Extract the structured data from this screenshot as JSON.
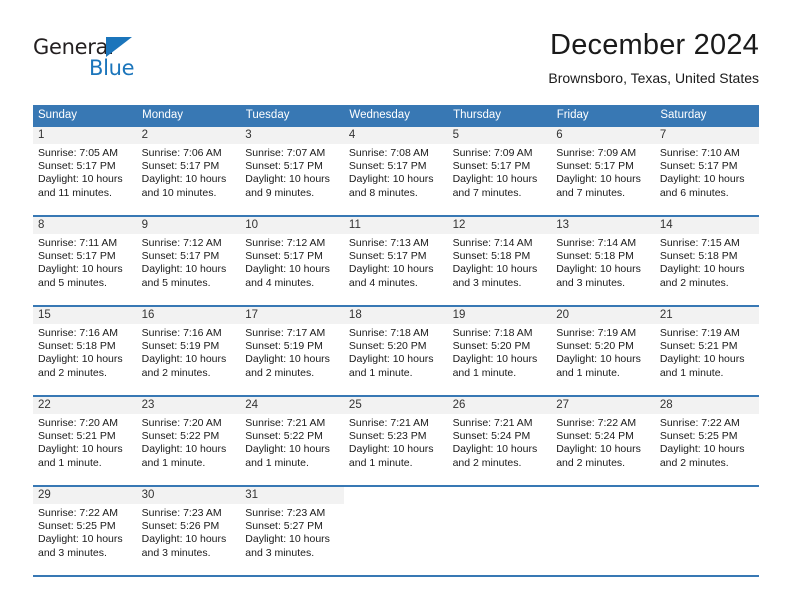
{
  "brand": {
    "name_part1": "General",
    "name_part2": "Blue",
    "accent_color": "#1b75bb"
  },
  "header": {
    "title": "December 2024",
    "subtitle": "Brownsboro, Texas, United States"
  },
  "calendar": {
    "header_bg": "#3878b4",
    "daynum_bg": "#f2f2f2",
    "weekday_headers": [
      "Sunday",
      "Monday",
      "Tuesday",
      "Wednesday",
      "Thursday",
      "Friday",
      "Saturday"
    ],
    "weeks": [
      [
        {
          "day": "1",
          "sunrise": "Sunrise: 7:05 AM",
          "sunset": "Sunset: 5:17 PM",
          "daylight_line1": "Daylight: 10 hours",
          "daylight_line2": "and 11 minutes."
        },
        {
          "day": "2",
          "sunrise": "Sunrise: 7:06 AM",
          "sunset": "Sunset: 5:17 PM",
          "daylight_line1": "Daylight: 10 hours",
          "daylight_line2": "and 10 minutes."
        },
        {
          "day": "3",
          "sunrise": "Sunrise: 7:07 AM",
          "sunset": "Sunset: 5:17 PM",
          "daylight_line1": "Daylight: 10 hours",
          "daylight_line2": "and 9 minutes."
        },
        {
          "day": "4",
          "sunrise": "Sunrise: 7:08 AM",
          "sunset": "Sunset: 5:17 PM",
          "daylight_line1": "Daylight: 10 hours",
          "daylight_line2": "and 8 minutes."
        },
        {
          "day": "5",
          "sunrise": "Sunrise: 7:09 AM",
          "sunset": "Sunset: 5:17 PM",
          "daylight_line1": "Daylight: 10 hours",
          "daylight_line2": "and 7 minutes."
        },
        {
          "day": "6",
          "sunrise": "Sunrise: 7:09 AM",
          "sunset": "Sunset: 5:17 PM",
          "daylight_line1": "Daylight: 10 hours",
          "daylight_line2": "and 7 minutes."
        },
        {
          "day": "7",
          "sunrise": "Sunrise: 7:10 AM",
          "sunset": "Sunset: 5:17 PM",
          "daylight_line1": "Daylight: 10 hours",
          "daylight_line2": "and 6 minutes."
        }
      ],
      [
        {
          "day": "8",
          "sunrise": "Sunrise: 7:11 AM",
          "sunset": "Sunset: 5:17 PM",
          "daylight_line1": "Daylight: 10 hours",
          "daylight_line2": "and 5 minutes."
        },
        {
          "day": "9",
          "sunrise": "Sunrise: 7:12 AM",
          "sunset": "Sunset: 5:17 PM",
          "daylight_line1": "Daylight: 10 hours",
          "daylight_line2": "and 5 minutes."
        },
        {
          "day": "10",
          "sunrise": "Sunrise: 7:12 AM",
          "sunset": "Sunset: 5:17 PM",
          "daylight_line1": "Daylight: 10 hours",
          "daylight_line2": "and 4 minutes."
        },
        {
          "day": "11",
          "sunrise": "Sunrise: 7:13 AM",
          "sunset": "Sunset: 5:17 PM",
          "daylight_line1": "Daylight: 10 hours",
          "daylight_line2": "and 4 minutes."
        },
        {
          "day": "12",
          "sunrise": "Sunrise: 7:14 AM",
          "sunset": "Sunset: 5:18 PM",
          "daylight_line1": "Daylight: 10 hours",
          "daylight_line2": "and 3 minutes."
        },
        {
          "day": "13",
          "sunrise": "Sunrise: 7:14 AM",
          "sunset": "Sunset: 5:18 PM",
          "daylight_line1": "Daylight: 10 hours",
          "daylight_line2": "and 3 minutes."
        },
        {
          "day": "14",
          "sunrise": "Sunrise: 7:15 AM",
          "sunset": "Sunset: 5:18 PM",
          "daylight_line1": "Daylight: 10 hours",
          "daylight_line2": "and 2 minutes."
        }
      ],
      [
        {
          "day": "15",
          "sunrise": "Sunrise: 7:16 AM",
          "sunset": "Sunset: 5:18 PM",
          "daylight_line1": "Daylight: 10 hours",
          "daylight_line2": "and 2 minutes."
        },
        {
          "day": "16",
          "sunrise": "Sunrise: 7:16 AM",
          "sunset": "Sunset: 5:19 PM",
          "daylight_line1": "Daylight: 10 hours",
          "daylight_line2": "and 2 minutes."
        },
        {
          "day": "17",
          "sunrise": "Sunrise: 7:17 AM",
          "sunset": "Sunset: 5:19 PM",
          "daylight_line1": "Daylight: 10 hours",
          "daylight_line2": "and 2 minutes."
        },
        {
          "day": "18",
          "sunrise": "Sunrise: 7:18 AM",
          "sunset": "Sunset: 5:20 PM",
          "daylight_line1": "Daylight: 10 hours",
          "daylight_line2": "and 1 minute."
        },
        {
          "day": "19",
          "sunrise": "Sunrise: 7:18 AM",
          "sunset": "Sunset: 5:20 PM",
          "daylight_line1": "Daylight: 10 hours",
          "daylight_line2": "and 1 minute."
        },
        {
          "day": "20",
          "sunrise": "Sunrise: 7:19 AM",
          "sunset": "Sunset: 5:20 PM",
          "daylight_line1": "Daylight: 10 hours",
          "daylight_line2": "and 1 minute."
        },
        {
          "day": "21",
          "sunrise": "Sunrise: 7:19 AM",
          "sunset": "Sunset: 5:21 PM",
          "daylight_line1": "Daylight: 10 hours",
          "daylight_line2": "and 1 minute."
        }
      ],
      [
        {
          "day": "22",
          "sunrise": "Sunrise: 7:20 AM",
          "sunset": "Sunset: 5:21 PM",
          "daylight_line1": "Daylight: 10 hours",
          "daylight_line2": "and 1 minute."
        },
        {
          "day": "23",
          "sunrise": "Sunrise: 7:20 AM",
          "sunset": "Sunset: 5:22 PM",
          "daylight_line1": "Daylight: 10 hours",
          "daylight_line2": "and 1 minute."
        },
        {
          "day": "24",
          "sunrise": "Sunrise: 7:21 AM",
          "sunset": "Sunset: 5:22 PM",
          "daylight_line1": "Daylight: 10 hours",
          "daylight_line2": "and 1 minute."
        },
        {
          "day": "25",
          "sunrise": "Sunrise: 7:21 AM",
          "sunset": "Sunset: 5:23 PM",
          "daylight_line1": "Daylight: 10 hours",
          "daylight_line2": "and 1 minute."
        },
        {
          "day": "26",
          "sunrise": "Sunrise: 7:21 AM",
          "sunset": "Sunset: 5:24 PM",
          "daylight_line1": "Daylight: 10 hours",
          "daylight_line2": "and 2 minutes."
        },
        {
          "day": "27",
          "sunrise": "Sunrise: 7:22 AM",
          "sunset": "Sunset: 5:24 PM",
          "daylight_line1": "Daylight: 10 hours",
          "daylight_line2": "and 2 minutes."
        },
        {
          "day": "28",
          "sunrise": "Sunrise: 7:22 AM",
          "sunset": "Sunset: 5:25 PM",
          "daylight_line1": "Daylight: 10 hours",
          "daylight_line2": "and 2 minutes."
        }
      ],
      [
        {
          "day": "29",
          "sunrise": "Sunrise: 7:22 AM",
          "sunset": "Sunset: 5:25 PM",
          "daylight_line1": "Daylight: 10 hours",
          "daylight_line2": "and 3 minutes."
        },
        {
          "day": "30",
          "sunrise": "Sunrise: 7:23 AM",
          "sunset": "Sunset: 5:26 PM",
          "daylight_line1": "Daylight: 10 hours",
          "daylight_line2": "and 3 minutes."
        },
        {
          "day": "31",
          "sunrise": "Sunrise: 7:23 AM",
          "sunset": "Sunset: 5:27 PM",
          "daylight_line1": "Daylight: 10 hours",
          "daylight_line2": "and 3 minutes."
        },
        {
          "day": "",
          "sunrise": "",
          "sunset": "",
          "daylight_line1": "",
          "daylight_line2": ""
        },
        {
          "day": "",
          "sunrise": "",
          "sunset": "",
          "daylight_line1": "",
          "daylight_line2": ""
        },
        {
          "day": "",
          "sunrise": "",
          "sunset": "",
          "daylight_line1": "",
          "daylight_line2": ""
        },
        {
          "day": "",
          "sunrise": "",
          "sunset": "",
          "daylight_line1": "",
          "daylight_line2": ""
        }
      ]
    ]
  }
}
